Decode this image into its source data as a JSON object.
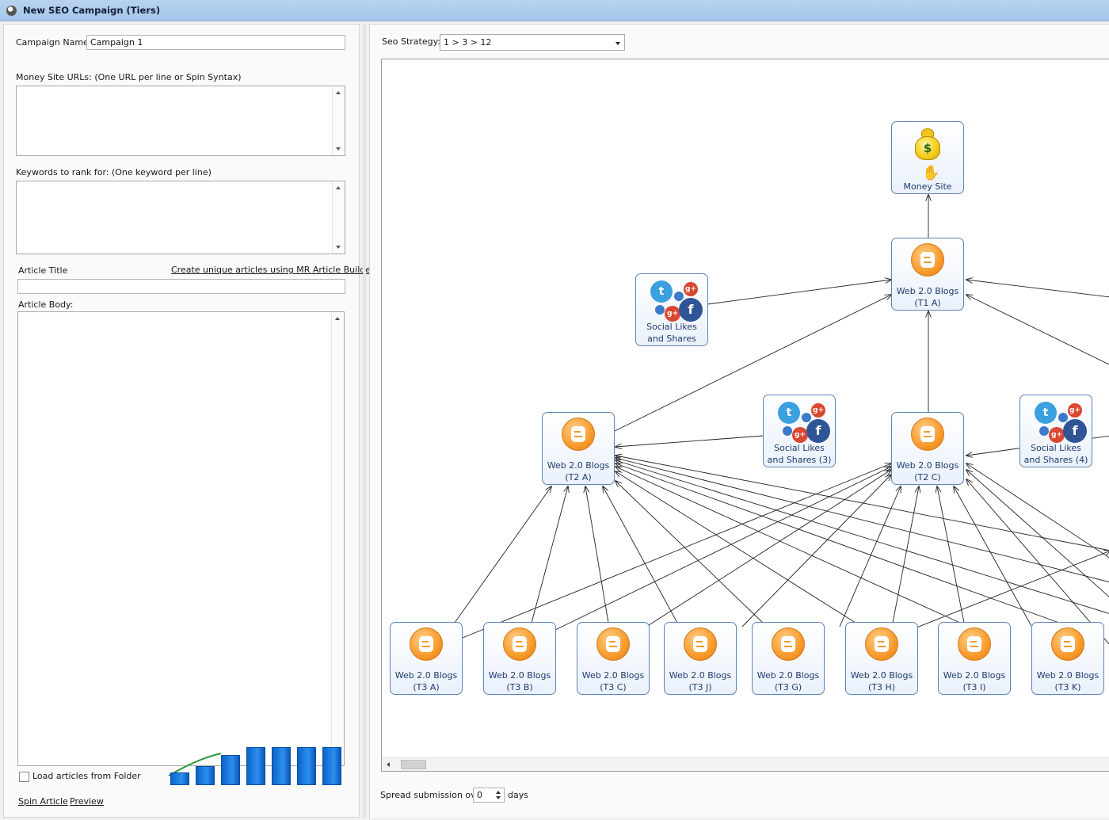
{
  "window": {
    "title": "New SEO Campaign (Tiers)"
  },
  "form": {
    "campaign_name_label": "Campaign Name:",
    "campaign_name_value": "Campaign 1",
    "money_urls_label": "Money Site URLs: (One URL per line or Spin Syntax)",
    "keywords_label": "Keywords to rank for: (One keyword per line)",
    "article_title_label": "Article Title",
    "article_builder_link": "Create unique articles using MR Article Builder",
    "article_body_label": "Article Body:",
    "load_folder_label": "Load articles from Folder",
    "spin_article_link": "Spin Article",
    "preview_link": "Preview"
  },
  "strategy": {
    "label": "Seo Strategy:",
    "value": "1 > 3 > 12"
  },
  "spread": {
    "prefix": "Spread submission over",
    "value": "0",
    "suffix": "days"
  },
  "diagram": {
    "money_site": "Money Site",
    "t1a": [
      "Web 2.0 Blogs",
      "(T1 A)"
    ],
    "social1": [
      "Social Likes",
      "and Shares"
    ],
    "t2a": [
      "Web 2.0 Blogs",
      "(T2 A)"
    ],
    "social3": [
      "Social Likes",
      "and Shares (3)"
    ],
    "t2c": [
      "Web 2.0 Blogs",
      "(T2 C)"
    ],
    "social4": [
      "Social Likes",
      "and Shares (4)"
    ],
    "t3": [
      [
        "Web 2.0 Blogs",
        "(T3 A)"
      ],
      [
        "Web 2.0 Blogs",
        "(T3 B)"
      ],
      [
        "Web 2.0 Blogs",
        "(T3 C)"
      ],
      [
        "Web 2.0 Blogs",
        "(T3 J)"
      ],
      [
        "Web 2.0 Blogs",
        "(T3 G)"
      ],
      [
        "Web 2.0 Blogs",
        "(T3 H)"
      ],
      [
        "Web 2.0 Blogs",
        "(T3 I)"
      ],
      [
        "Web 2.0 Blogs",
        "(T3 K)"
      ]
    ]
  },
  "icons": {
    "app": "app-icon",
    "blogger": "blogger-icon",
    "social": "social-icon",
    "money": "money-bag-icon",
    "cursor": "hand-cursor-icon"
  },
  "colors": {
    "titlebar": "#b0cdee",
    "node_border": "#5d84b8",
    "blogger": "#f79a2b",
    "bars": "#1a78e0"
  }
}
